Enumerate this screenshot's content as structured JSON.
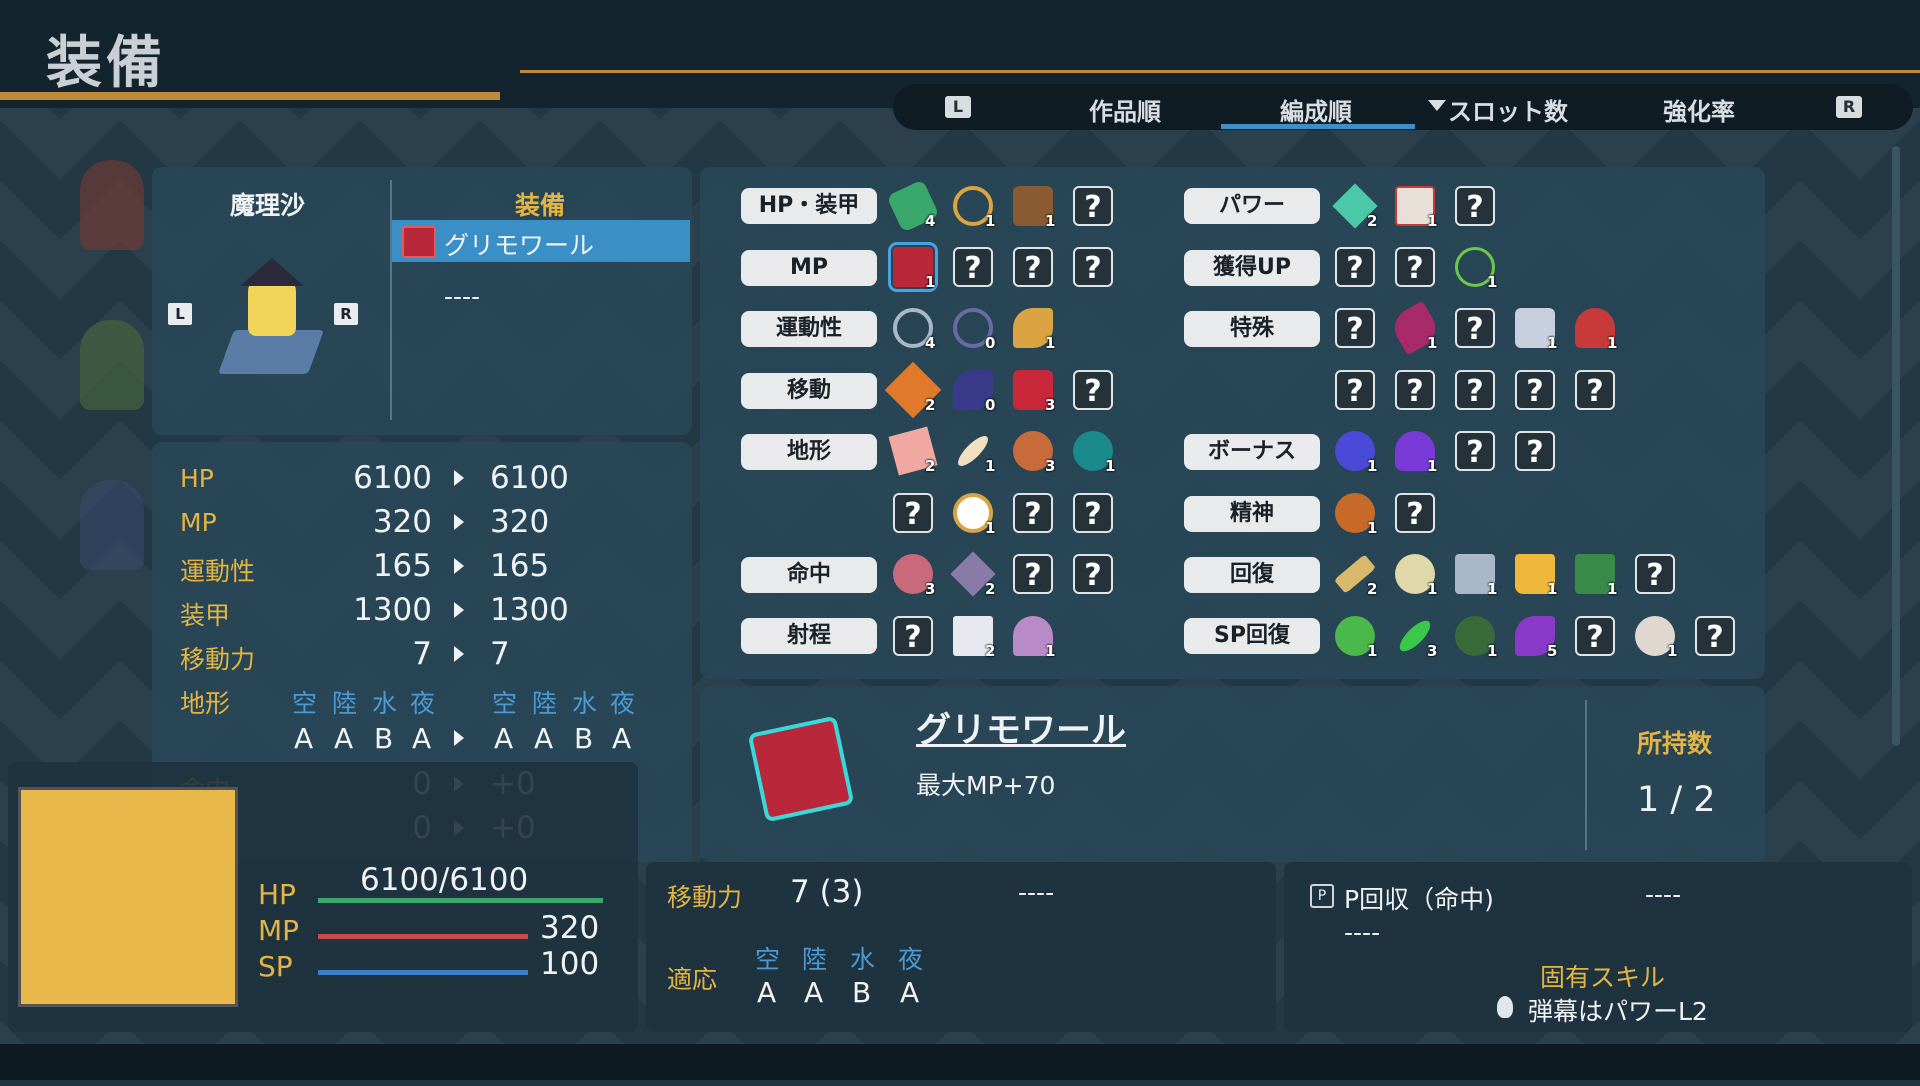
{
  "header": {
    "title": "装備"
  },
  "sort_tabs": {
    "left_key": "L",
    "right_key": "R",
    "tabs": [
      "作品順",
      "編成順",
      "スロット数",
      "強化率"
    ],
    "active": "編成順"
  },
  "character": {
    "name": "魔理沙",
    "equip_header": "装備",
    "equipped_item": "グリモワール",
    "empty_slot": "----",
    "key_left": "L",
    "key_right": "R"
  },
  "stats": {
    "rows": [
      {
        "label": "HP",
        "before": "6100",
        "after": "6100"
      },
      {
        "label": "MP",
        "before": "320",
        "after": "320"
      },
      {
        "label": "運動性",
        "before": "165",
        "after": "165"
      },
      {
        "label": "装甲",
        "before": "1300",
        "after": "1300"
      },
      {
        "label": "移動力",
        "before": "7",
        "after": "7"
      }
    ],
    "terrain_label": "地形",
    "terrain_heads": [
      "空",
      "陸",
      "水",
      "夜"
    ],
    "terrain_before": [
      "A",
      "A",
      "B",
      "A"
    ],
    "terrain_after": [
      "A",
      "A",
      "B",
      "A"
    ],
    "rows2": [
      {
        "label": "命中",
        "before": "0",
        "after": "+0"
      },
      {
        "label": "射程",
        "before": "0",
        "after": "+0"
      }
    ]
  },
  "inventory": {
    "left_categories": [
      "HP・装甲",
      "MP",
      "運動性",
      "移動",
      "地形",
      "命中",
      "射程"
    ],
    "right_categories": [
      "パワー",
      "獲得UP",
      "特殊",
      "ボーナス",
      "精神",
      "回復",
      "SP回復"
    ],
    "unknown_glyph": "?",
    "counts": {
      "hp_armor": [
        "4",
        "1",
        "1"
      ],
      "mp": [
        "1"
      ],
      "mobility": [
        "4",
        "0",
        "1"
      ],
      "move": [
        "2",
        "0",
        "3"
      ],
      "terrain1": [
        "2",
        "1",
        "3",
        "1"
      ],
      "terrain2": [
        "1"
      ],
      "hit": [
        "3",
        "2"
      ],
      "range": [
        "2",
        "1"
      ],
      "power": [
        "2",
        "1"
      ],
      "gain": [
        "1"
      ],
      "special": [
        "1",
        "1",
        "1"
      ],
      "bonus": [
        "1",
        "1"
      ],
      "spirit": [
        "1"
      ],
      "recover": [
        "2",
        "1",
        "1",
        "1",
        "1"
      ],
      "sp_recover": [
        "1",
        "3",
        "1",
        "5",
        "1"
      ]
    }
  },
  "detail": {
    "item_name": "グリモワール",
    "effect": "最大MP+70",
    "owned_label": "所持数",
    "owned_value": "1 / 2"
  },
  "bottom": {
    "hp_label": "HP",
    "hp_value": "6100/6100",
    "mp_label": "MP",
    "mp_value": "320",
    "sp_label": "SP",
    "sp_value": "100",
    "move_label": "移動力",
    "move_value": "7 (3)",
    "move_dash": "----",
    "adapt_label": "適応",
    "adapt_heads": [
      "空",
      "陸",
      "水",
      "夜"
    ],
    "adapt_vals": [
      "A",
      "A",
      "B",
      "A"
    ],
    "skill_p": "P回収（命中)",
    "skill_dash1": "----",
    "skill_dash2": "----",
    "skill_dash3": "----",
    "unique_label": "固有スキル",
    "unique_value": "弾幕はパワーL2"
  },
  "colors": {
    "accent_blue": "#3a90c6",
    "gold": "#e3b443",
    "hp_green": "#3aa86a",
    "mp_red": "#c84a4a",
    "sp_blue": "#3a7ec8"
  }
}
